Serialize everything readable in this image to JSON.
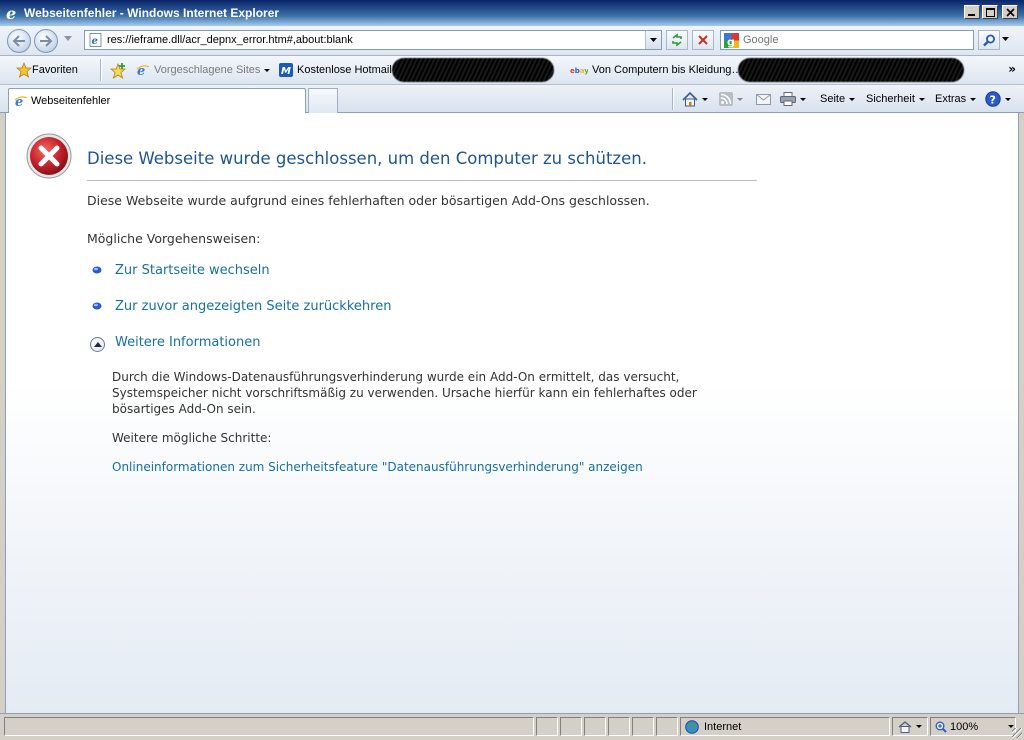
{
  "window": {
    "title": "Webseitenfehler - Windows Internet Explorer"
  },
  "address": {
    "url": "res://ieframe.dll/acr_depnx_error.htm#,about:blank"
  },
  "search": {
    "placeholder": "Google"
  },
  "favorites_bar": {
    "favorites_label": "Favoriten",
    "items": [
      {
        "label": "Vorgeschlagene Sites",
        "icon": "ie-icon"
      },
      {
        "label": "Kostenlose Hotmail",
        "icon": "msn-icon"
      },
      {
        "label": "Von Computern bis Kleidung…",
        "icon": "ebay-icon"
      }
    ]
  },
  "tabs": [
    {
      "label": "Webseitenfehler"
    }
  ],
  "command_bar": {
    "page_label": "Seite",
    "safety_label": "Sicherheit",
    "tools_label": "Extras"
  },
  "content": {
    "heading": "Diese Webseite wurde geschlossen, um den Computer zu schützen.",
    "description": "Diese Webseite wurde aufgrund eines fehlerhaften oder bösartigen Add-Ons geschlossen.",
    "options_heading": "Mögliche Vorgehensweisen:",
    "actions": [
      {
        "label": "Zur Startseite wechseln"
      },
      {
        "label": "Zur zuvor angezeigten Seite zurückkehren"
      }
    ],
    "more_info_label": "Weitere Informationen",
    "details_text": "Durch die Windows-Datenausführungsverhinderung wurde ein Add-On ermittelt, das versucht, Systemspeicher nicht vorschriftsmäßig zu verwenden. Ursache hierfür kann ein fehlerhaftes oder bösartiges Add-On sein.",
    "further_steps_heading": "Weitere mögliche Schritte:",
    "online_info_link": "Onlineinformationen zum Sicherheitsfeature \"Datenausführungsverhinderung\" anzeigen"
  },
  "status_bar": {
    "zone": "Internet",
    "zoom": "100%"
  },
  "colors": {
    "heading": "#1f5590",
    "link": "#1670a0",
    "error_red": "#c8232c"
  }
}
